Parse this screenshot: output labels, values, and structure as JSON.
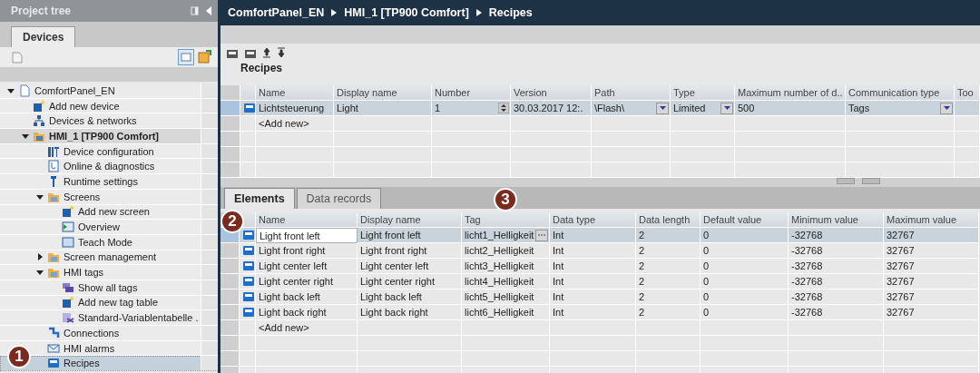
{
  "project_tree": {
    "title": "Project tree",
    "tabs": [
      {
        "label": "Devices",
        "selected": true
      }
    ],
    "tree": [
      {
        "label": "ComfortPanel_EN",
        "kind": "project",
        "selected": false,
        "expanded": true,
        "children": [
          {
            "label": "Add new device",
            "kind": "add",
            "selected": false
          },
          {
            "label": "Devices & networks",
            "kind": "network",
            "selected": false
          },
          {
            "label": "HMI_1 [TP900 Comfort]",
            "kind": "device",
            "selected": false,
            "expanded": true,
            "children": [
              {
                "label": "Device configuration",
                "kind": "config",
                "selected": false
              },
              {
                "label": "Online & diagnostics",
                "kind": "diagnostics",
                "selected": false
              },
              {
                "label": "Runtime settings",
                "kind": "runtime",
                "selected": false
              },
              {
                "label": "Screens",
                "kind": "folder",
                "selected": false,
                "expanded": true,
                "children": [
                  {
                    "label": "Add new screen",
                    "kind": "add",
                    "selected": false
                  },
                  {
                    "label": "Overview",
                    "kind": "start-screen",
                    "selected": false
                  },
                  {
                    "label": "Teach Mode",
                    "kind": "screen",
                    "selected": false
                  }
                ]
              },
              {
                "label": "Screen management",
                "kind": "folder",
                "selected": false,
                "expanded": false
              },
              {
                "label": "HMI tags",
                "kind": "folder",
                "selected": false,
                "expanded": true,
                "children": [
                  {
                    "label": "Show all tags",
                    "kind": "tags",
                    "selected": false
                  },
                  {
                    "label": "Add new tag table",
                    "kind": "add",
                    "selected": false
                  },
                  {
                    "label": "Standard-Variablentabelle .",
                    "kind": "tag-table",
                    "selected": false
                  }
                ]
              },
              {
                "label": "Connections",
                "kind": "connection",
                "selected": false
              },
              {
                "label": "HMI alarms",
                "kind": "alarm",
                "selected": false
              },
              {
                "label": "Recipes",
                "kind": "recipe",
                "selected": true
              }
            ]
          }
        ]
      }
    ]
  },
  "breadcrumb": [
    "ComfortPanel_EN",
    "HMI_1 [TP900 Comfort]",
    "Recipes"
  ],
  "recipes": {
    "title": "Recipes",
    "columns": [
      {
        "label": "Name",
        "kind": "text"
      },
      {
        "label": "Display name",
        "kind": "text"
      },
      {
        "label": "Number",
        "kind": "spinner"
      },
      {
        "label": "Version",
        "kind": "text"
      },
      {
        "label": "Path",
        "kind": "dropdown"
      },
      {
        "label": "Type",
        "kind": "dropdown"
      },
      {
        "label": "Maximum number of d..",
        "kind": "text"
      },
      {
        "label": "Communication type",
        "kind": "dropdown"
      },
      {
        "label": "Too",
        "kind": "text"
      }
    ],
    "rows": [
      {
        "selected": true,
        "cells": [
          "Lichtsteuerung",
          "Light",
          "1",
          "30.03.2017 12:.",
          "\\Flash\\",
          "Limited",
          "500",
          "Tags"
        ]
      }
    ],
    "add_new": "<Add new>"
  },
  "editor_tabs": [
    {
      "label": "Elements",
      "selected": true
    },
    {
      "label": "Data records",
      "selected": false
    }
  ],
  "elements": {
    "columns": [
      {
        "label": "Name",
        "kind": "text"
      },
      {
        "label": "Display name",
        "kind": "text"
      },
      {
        "label": "Tag",
        "kind": "tag"
      },
      {
        "label": "Data type",
        "kind": "text"
      },
      {
        "label": "Data length",
        "kind": "text"
      },
      {
        "label": "Default value",
        "kind": "text"
      },
      {
        "label": "Minimum value",
        "kind": "text"
      },
      {
        "label": "Maximum value",
        "kind": "text"
      }
    ],
    "rows": [
      {
        "selected": true,
        "cells": [
          "Light front left",
          "Light front left",
          "licht1_Helligkeit",
          "Int",
          "2",
          "0",
          "-32768",
          "32767"
        ]
      },
      {
        "selected": false,
        "cells": [
          "Light front right",
          "Light front right",
          "licht2_Helligkeit",
          "Int",
          "2",
          "0",
          "-32768",
          "32767"
        ]
      },
      {
        "selected": false,
        "cells": [
          "Light center left",
          "Light center left",
          "licht3_Helligkeit",
          "Int",
          "2",
          "0",
          "-32768",
          "32767"
        ]
      },
      {
        "selected": false,
        "cells": [
          "Light center right",
          "Light center right",
          "licht4_Helligkeit",
          "Int",
          "2",
          "0",
          "-32768",
          "32767"
        ]
      },
      {
        "selected": false,
        "cells": [
          "Light back left",
          "Light back left",
          "licht5_Helligkeit",
          "Int",
          "2",
          "0",
          "-32768",
          "32767"
        ]
      },
      {
        "selected": false,
        "cells": [
          "Light back right",
          "Light back right",
          "licht6_Helligkeit",
          "Int",
          "2",
          "0",
          "-32768",
          "32767"
        ]
      }
    ],
    "add_new": "<Add new>"
  },
  "callouts": [
    "1",
    "2",
    "3"
  ]
}
